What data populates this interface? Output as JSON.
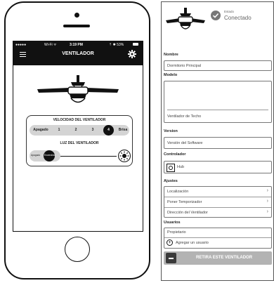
{
  "phone": {
    "status_bar": {
      "carrier": "●●●●●",
      "network": "Wi-Fi ᯤ",
      "time": "3:19 PM",
      "battery": "⇡ ✱ 53%"
    },
    "title": "VENTILADOR",
    "speed": {
      "title": "VELOCIDAD DEL VENTILADOR",
      "options": [
        "Apagado",
        "1",
        "2",
        "3",
        "4",
        "Brisa"
      ],
      "selected": "4"
    },
    "light": {
      "title": "LUZ DEL VENTILADOR",
      "off_label": "Apagado",
      "on_label": "Encendido"
    }
  },
  "settings": {
    "status": {
      "label": "Estado",
      "value": "Conectado"
    },
    "sections": {
      "name_label": "Nombre",
      "name_value": "Dormitorio Principal",
      "model_label": "Modelo",
      "model_value": "Ventilador de Techo",
      "version_label": "Version",
      "version_value": "Versión del Software",
      "controller_label": "Controlador",
      "controller_value": "Hub",
      "settings_label": "Ajustes",
      "settings_items": [
        "Localización",
        "Poner Temporizador",
        "Dirección del Ventilador"
      ],
      "users_label": "Usuarios",
      "users_owner": "Propietario",
      "users_add": "Agregar un usuario"
    },
    "remove_button": "RETIRA ESTE VENTILADOR"
  }
}
